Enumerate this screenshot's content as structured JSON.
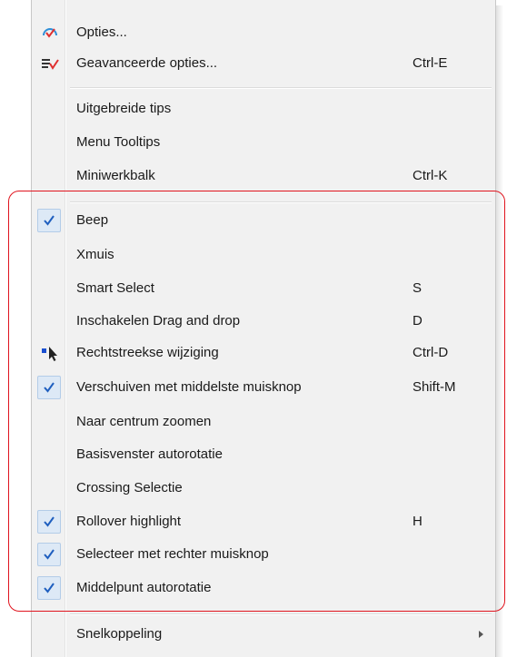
{
  "menu": {
    "items": [
      {
        "label": "Opties...",
        "shortcut": "",
        "icon": "options-gauge-icon",
        "checked": false
      },
      {
        "label": "Geavanceerde opties...",
        "shortcut": "Ctrl-E",
        "icon": "advanced-options-icon",
        "checked": false
      },
      {
        "label": "Uitgebreide tips",
        "shortcut": "",
        "icon": "",
        "checked": false
      },
      {
        "label": "Menu Tooltips",
        "shortcut": "",
        "icon": "",
        "checked": false
      },
      {
        "label": "Miniwerkbalk",
        "shortcut": "Ctrl-K",
        "icon": "",
        "checked": false
      },
      {
        "label": "Beep",
        "shortcut": "",
        "icon": "",
        "checked": true
      },
      {
        "label": "Xmuis",
        "shortcut": "",
        "icon": "",
        "checked": false
      },
      {
        "label": "Smart Select",
        "shortcut": "S",
        "icon": "",
        "checked": false
      },
      {
        "label": "Inschakelen Drag and drop",
        "shortcut": "D",
        "icon": "",
        "checked": false
      },
      {
        "label": "Rechtstreekse wijziging",
        "shortcut": "Ctrl-D",
        "icon": "direct-edit-cursor-icon",
        "checked": false
      },
      {
        "label": "Verschuiven met middelste muisknop",
        "shortcut": "Shift-M",
        "icon": "",
        "checked": true
      },
      {
        "label": "Naar centrum zoomen",
        "shortcut": "",
        "icon": "",
        "checked": false
      },
      {
        "label": "Basisvenster autorotatie",
        "shortcut": "",
        "icon": "",
        "checked": false
      },
      {
        "label": "Crossing Selectie",
        "shortcut": "",
        "icon": "",
        "checked": false
      },
      {
        "label": "Rollover highlight",
        "shortcut": "H",
        "icon": "",
        "checked": true
      },
      {
        "label": "Selecteer met rechter muisknop",
        "shortcut": "",
        "icon": "",
        "checked": true
      },
      {
        "label": "Middelpunt autorotatie",
        "shortcut": "",
        "icon": "",
        "checked": true
      },
      {
        "label": "Snelkoppeling",
        "shortcut": "",
        "icon": "submenu-arrow-icon",
        "checked": false
      }
    ]
  },
  "colors": {
    "menu_background": "#f1f1f1",
    "check_mark": "#1f5fbf",
    "check_background": "#dde9f6",
    "annotation_outline": "#e0141e"
  }
}
